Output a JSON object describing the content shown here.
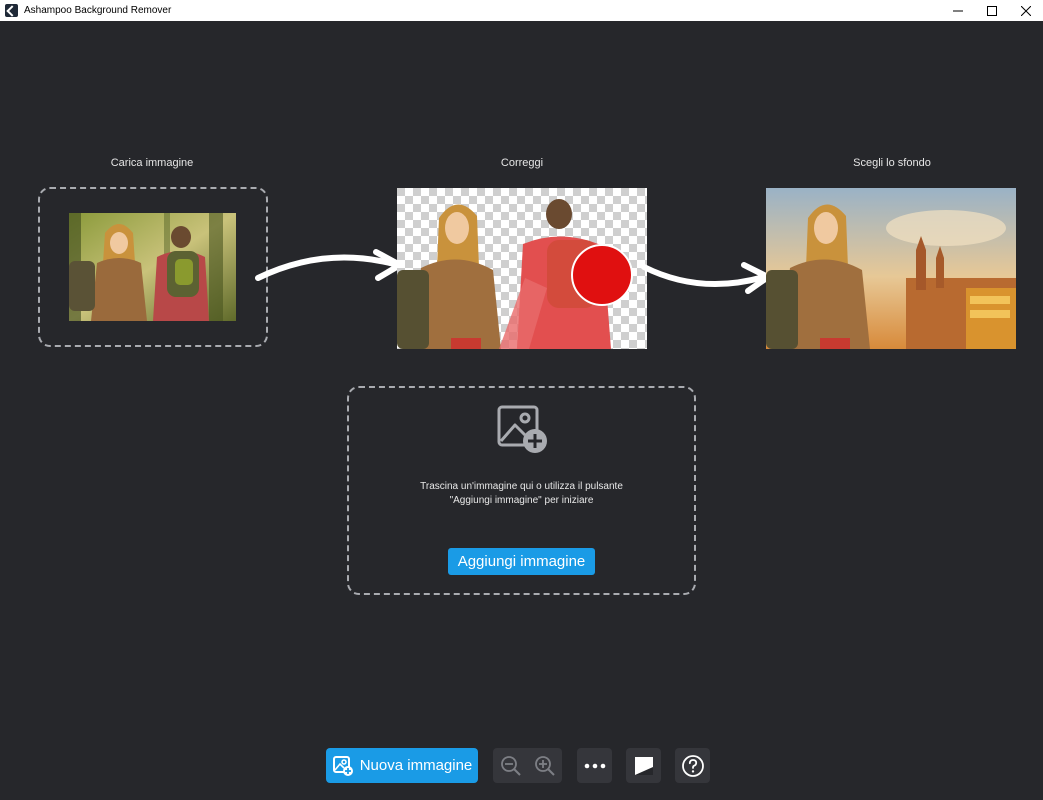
{
  "window": {
    "title": "Ashampoo Background Remover"
  },
  "steps": [
    {
      "label": "Carica immagine"
    },
    {
      "label": "Correggi"
    },
    {
      "label": "Scegli lo sfondo"
    }
  ],
  "dropzone": {
    "line1": "Trascina un'immagine qui o utilizza il pulsante",
    "line2": "\"Aggiungi immagine\" per iniziare",
    "button_label": "Aggiungi immagine"
  },
  "toolbar": {
    "new_image_label": "Nuova immagine"
  },
  "colors": {
    "background": "#26272b",
    "accent": "#1a9be6",
    "toolbar_button": "#35363b"
  },
  "icons": [
    "app-icon",
    "minimize-icon",
    "maximize-icon",
    "close-icon",
    "add-image-icon",
    "new-image-icon",
    "zoom-out-icon",
    "zoom-in-icon",
    "more-icon",
    "compare-icon",
    "help-icon"
  ]
}
